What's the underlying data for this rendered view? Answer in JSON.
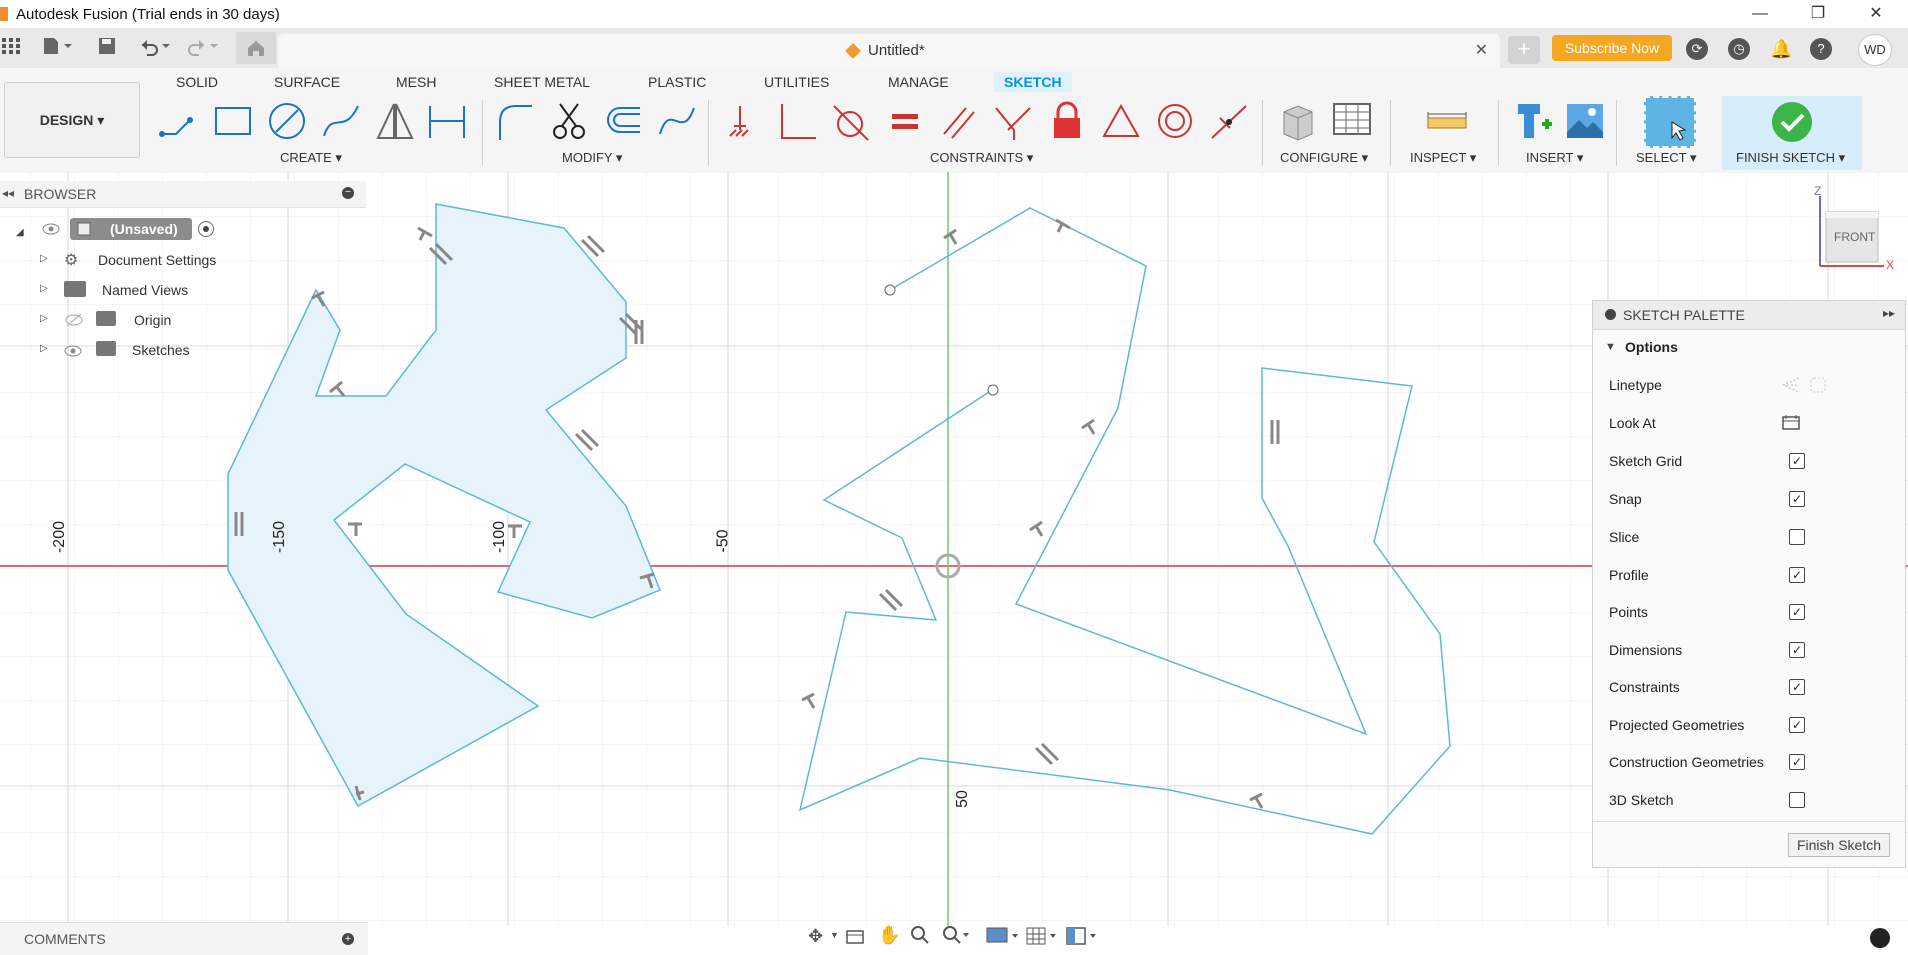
{
  "window": {
    "title": "Autodesk Fusion (Trial ends in 30 days)",
    "minimize": "—",
    "restore": "❐",
    "close": "✕"
  },
  "tabs": {
    "document_name": "Untitled*",
    "close": "✕",
    "new_tab": "+",
    "subscribe": "Subscribe Now",
    "user_initials": "WD"
  },
  "toolbar": {
    "design": "DESIGN ▾",
    "workspace_tabs": [
      "SOLID",
      "SURFACE",
      "MESH",
      "SHEET METAL",
      "PLASTIC",
      "UTILITIES",
      "MANAGE",
      "SKETCH"
    ],
    "active_tab": "SKETCH",
    "groups": {
      "create": "CREATE ▾",
      "modify": "MODIFY ▾",
      "constraints": "CONSTRAINTS ▾",
      "configure": "CONFIGURE ▾",
      "inspect": "INSPECT ▾",
      "insert": "INSERT ▾",
      "select": "SELECT ▾",
      "finish_sketch": "FINISH SKETCH ▾"
    }
  },
  "browser": {
    "title": "BROWSER",
    "root": "(Unsaved)",
    "items": [
      "Document Settings",
      "Named Views",
      "Origin",
      "Sketches"
    ]
  },
  "viewcube": {
    "face": "FRONT",
    "axis_z": "Z",
    "axis_x": "X"
  },
  "axis_labels": {
    "h1": "-200",
    "h2": "-150",
    "h3": "-100",
    "h4": "-50",
    "v1": "50"
  },
  "sketch_palette": {
    "title": "SKETCH PALETTE",
    "section": "Options",
    "rows": [
      {
        "label": "Linetype",
        "kind": "icons"
      },
      {
        "label": "Look At",
        "kind": "icon"
      },
      {
        "label": "Sketch Grid",
        "checked": true
      },
      {
        "label": "Snap",
        "checked": true
      },
      {
        "label": "Slice",
        "checked": false
      },
      {
        "label": "Profile",
        "checked": true
      },
      {
        "label": "Points",
        "checked": true
      },
      {
        "label": "Dimensions",
        "checked": true
      },
      {
        "label": "Constraints",
        "checked": true
      },
      {
        "label": "Projected Geometries",
        "checked": true
      },
      {
        "label": "Construction Geometries",
        "checked": true
      },
      {
        "label": "3D Sketch",
        "checked": false
      }
    ],
    "finish_button": "Finish Sketch"
  },
  "comments": {
    "title": "COMMENTS"
  },
  "colors": {
    "sketch_line": "#5bb8de",
    "profile_fill": "#e7f3fb",
    "x_axis": "#e06a6a",
    "y_axis": "#6dcc6d",
    "accent": "#0696d7",
    "subscribe": "#f5a623"
  }
}
